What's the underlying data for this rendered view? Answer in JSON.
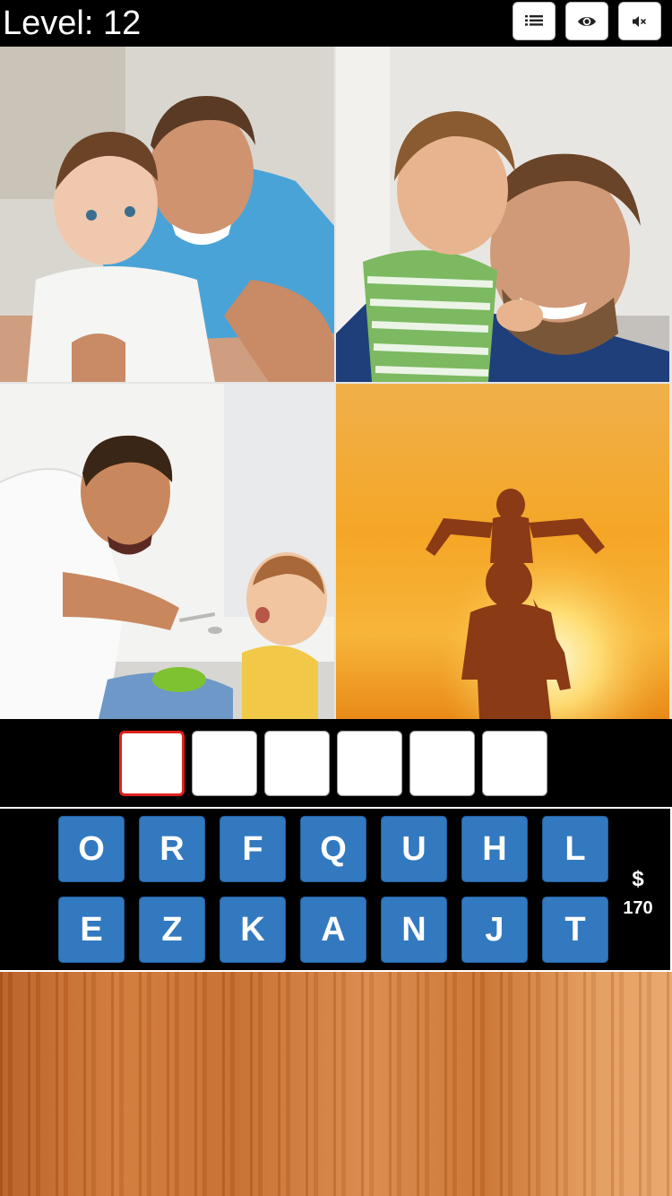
{
  "header": {
    "level_text": "Level: 12",
    "buttons": [
      {
        "icon": "list-icon"
      },
      {
        "icon": "eye-icon"
      },
      {
        "icon": "mute-icon"
      }
    ]
  },
  "photos": [
    {
      "subject": "father-with-baby-indoors"
    },
    {
      "subject": "toddler-kissing-father"
    },
    {
      "subject": "father-feeding-baby"
    },
    {
      "subject": "child-on-shoulders-sunset"
    }
  ],
  "answer": {
    "slots": [
      "",
      "",
      "",
      "",
      "",
      ""
    ],
    "active_index": 0
  },
  "keyboard": {
    "row1": [
      "O",
      "R",
      "F",
      "Q",
      "U",
      "H",
      "L"
    ],
    "row2": [
      "E",
      "Z",
      "K",
      "A",
      "N",
      "J",
      "T"
    ]
  },
  "coins": {
    "symbol": "$",
    "amount": "170"
  },
  "colors": {
    "key": "#3379c0",
    "active_slot_border": "#e0201c",
    "background": "#000000"
  }
}
